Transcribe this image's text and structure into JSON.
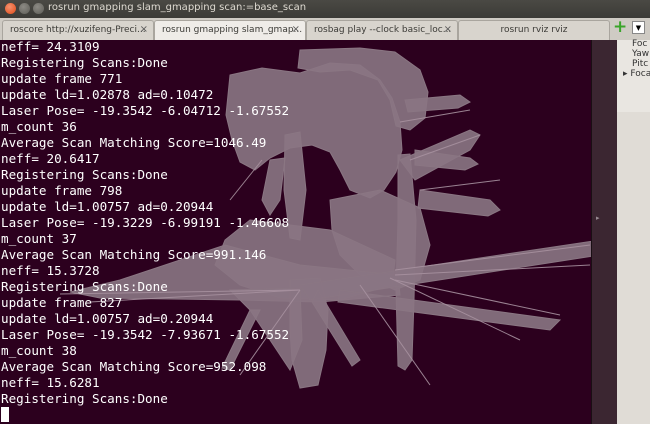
{
  "window": {
    "title": "rosrun gmapping slam_gmapping scan:=base_scan"
  },
  "tabs": [
    {
      "label": "roscore http://xuzifeng-Preci...",
      "close": "×",
      "active": false
    },
    {
      "label": "rosrun gmapping slam_gmap...",
      "close": "×",
      "active": true
    },
    {
      "label": "rosbag play --clock basic_loc...",
      "close": "×",
      "active": false
    },
    {
      "label": "rosrun rviz rviz",
      "close": "×",
      "active": false
    }
  ],
  "tab_actions": {
    "new_tab": "+",
    "menu": "▼"
  },
  "terminal": {
    "lines": [
      "neff= 24.3109",
      "Registering Scans:Done",
      "update frame 771",
      "update ld=1.02878 ad=0.10472",
      "Laser Pose= -19.3542 -6.04712 -1.67552",
      "m_count 36",
      "Average Scan Matching Score=1046.49",
      "neff= 20.6417",
      "Registering Scans:Done",
      "update frame 798",
      "update ld=1.00757 ad=0.20944",
      "Laser Pose= -19.3229 -6.99191 -1.46608",
      "m_count 37",
      "Average Scan Matching Score=991.146",
      "neff= 15.3728",
      "Registering Scans:Done",
      "update frame 827",
      "update ld=1.00757 ad=0.20944",
      "Laser Pose= -19.3542 -7.93671 -1.67552",
      "m_count 38",
      "Average Scan Matching Score=952.098",
      "neff= 15.6281",
      "Registering Scans:Done"
    ]
  },
  "side_panel": {
    "items": [
      "Foc",
      "Yaw",
      "Pitc",
      "Foca"
    ],
    "splitter_arrow": "▸"
  },
  "colors": {
    "terminal_bg": "#2c001e",
    "terminal_fg": "#ffffff",
    "map_overlay": "#8f7a88"
  }
}
